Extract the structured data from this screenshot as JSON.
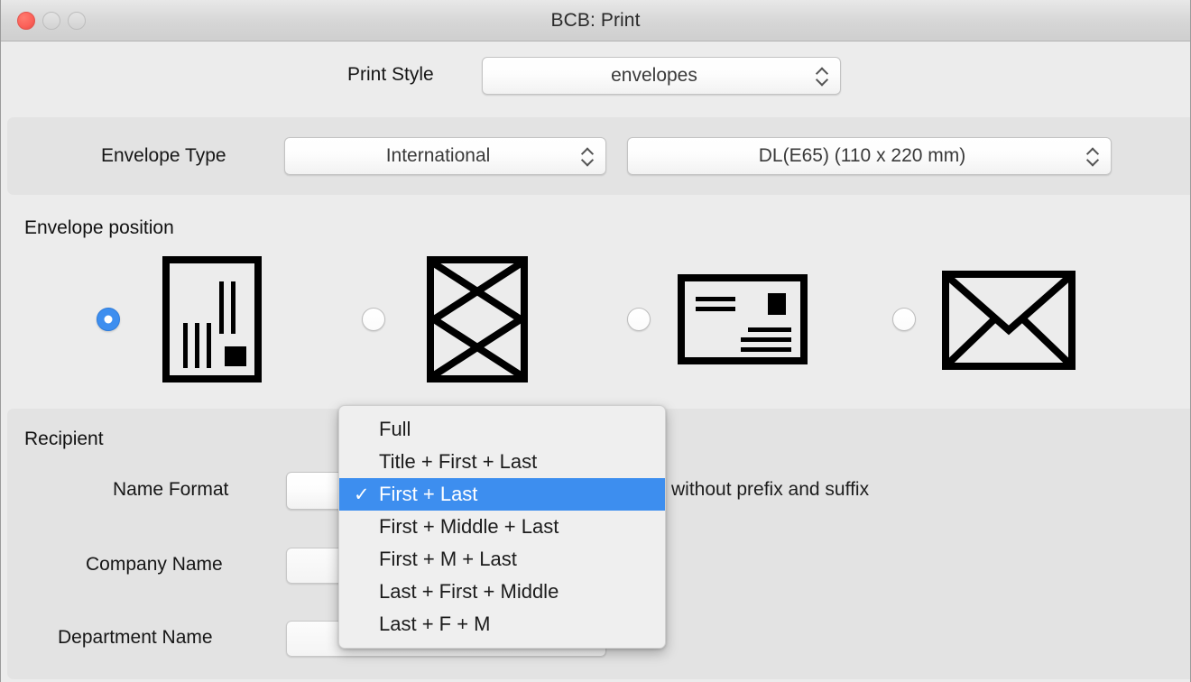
{
  "window": {
    "title": "BCB: Print",
    "traffic_lights": [
      "close",
      "minimize",
      "maximize"
    ]
  },
  "print_style": {
    "label": "Print Style",
    "value": "envelopes",
    "options": [
      "envelopes"
    ]
  },
  "envelope_type": {
    "label": "Envelope Type",
    "region_value": "International",
    "size_value": "DL(E65)  (110 x 220 mm)"
  },
  "envelope_position": {
    "label": "Envelope position",
    "selected_index": 0,
    "options": [
      {
        "icon": "envelope-portrait-address-icon",
        "selected": true
      },
      {
        "icon": "envelope-portrait-back-flap-icon",
        "selected": false
      },
      {
        "icon": "envelope-landscape-address-icon",
        "selected": false
      },
      {
        "icon": "envelope-landscape-front-flap-icon",
        "selected": false
      }
    ]
  },
  "recipient": {
    "label": "Recipient",
    "name_format": {
      "label": "Name Format",
      "value": "First + Last",
      "hint": "without prefix and suffix"
    },
    "company_name": {
      "label": "Company Name",
      "value": ""
    },
    "department_name": {
      "label": "Department Name",
      "value": ""
    }
  },
  "name_format_menu": {
    "open": true,
    "selected": "First + Last",
    "highlight_color": "#3d8eef",
    "items": [
      {
        "label": "Full",
        "checked": false
      },
      {
        "label": "Title + First + Last",
        "checked": false
      },
      {
        "label": "First + Last",
        "checked": true
      },
      {
        "label": "First + Middle + Last",
        "checked": false
      },
      {
        "label": "First + M + Last",
        "checked": false
      },
      {
        "label": "Last + First + Middle",
        "checked": false
      },
      {
        "label": "Last + F + M",
        "checked": false
      }
    ],
    "check_glyph": "✓"
  },
  "colors": {
    "accent": "#3d8eef",
    "window_bg": "#ececec",
    "panel_bg": "#e3e3e3",
    "close_button": "#fb6058"
  }
}
